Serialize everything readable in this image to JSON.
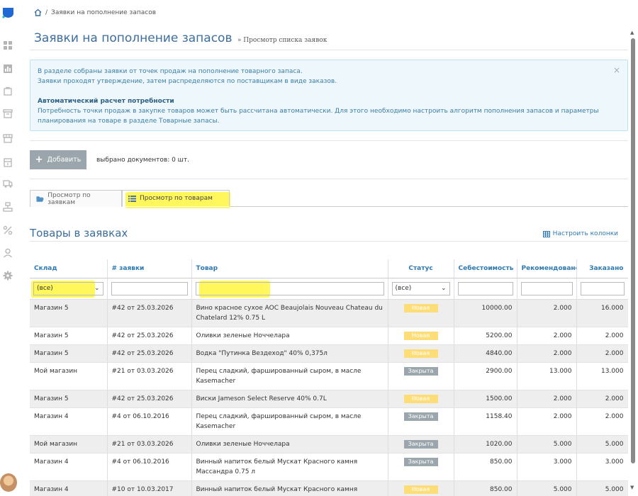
{
  "colors": {
    "accent": "#3b6e9e",
    "link": "#2f7ab3",
    "badge_new": "#fddd78",
    "badge_closed": "#9aa6ab",
    "highlight": "#fff64a"
  },
  "rail": {
    "icons": [
      "dashboard-icon",
      "chart-icon",
      "bag-icon",
      "archive-icon",
      "store-icon",
      "box-icon",
      "truck-icon",
      "org-icon",
      "percent-icon",
      "user-icon",
      "gear-icon"
    ]
  },
  "breadcrumb": {
    "separator": "/",
    "current": "Заявки на пополнение запасов"
  },
  "page": {
    "title": "Заявки на пополнение запасов",
    "subtitle": "» Просмотр списка заявок"
  },
  "info": {
    "line1": "В разделе собраны заявки от точек продаж на пополнение товарного запаса.",
    "line2_prefix": "Заявки проходят утверждение, затем распределяются по ",
    "line2_link": "поставщикам в виде заказов",
    "line2_suffix": ".",
    "heading": "Автоматический расчет потребности",
    "line3": "Потребность точки продаж в закупке товаров может быть рассчитана автоматически. Для этого необходимо настроить алгоритм пополнения запасов и параметры",
    "line4_prefix": "планирования на товаре в разделе ",
    "line4_link": "Товарные запасы",
    "line4_suffix": ".",
    "close": "×"
  },
  "toolbar": {
    "add_label": "Добавить",
    "selected_count": "выбрано документов: 0 шт."
  },
  "tabs": [
    {
      "label": "Просмотр по заявкам"
    },
    {
      "label": "Просмотр по товарам"
    }
  ],
  "section": {
    "title": "Товары в заявках",
    "configure_label": "Настроить колонки"
  },
  "table": {
    "headers": [
      "Склад",
      "# заявки",
      "Товар",
      "Статус",
      "Себестоимость",
      "Рекомендовано",
      "Заказано"
    ],
    "filters": {
      "warehouse": "(все)",
      "status": "(все)"
    },
    "rows": [
      {
        "warehouse": "Магазин 5",
        "order": "#42 от 25.03.2026",
        "product": "Вино красное сухое AOC Beaujolais Nouveau Chateau du Chatelard 12% 0.75 L",
        "status": "Новая",
        "status_type": "new",
        "cost": "10000.00",
        "recommended": "2.000",
        "ordered": "16.000"
      },
      {
        "warehouse": "Магазин 5",
        "order": "#42 от 25.03.2026",
        "product": "Оливки зеленые Ноччелара",
        "status": "Новая",
        "status_type": "new",
        "cost": "5200.00",
        "recommended": "2.000",
        "ordered": "2.000"
      },
      {
        "warehouse": "Магазин 5",
        "order": "#42 от 25.03.2026",
        "product": "Водка \"Путинка Вездеход\" 40% 0,375л",
        "status": "Новая",
        "status_type": "new",
        "cost": "4840.00",
        "recommended": "2.000",
        "ordered": "2.000"
      },
      {
        "warehouse": "Мой магазин",
        "order": "#21 от 03.03.2026",
        "product": "Перец сладкий, фаршированный сыром, в масле Kasemacher",
        "status": "Закрыта",
        "status_type": "closed",
        "cost": "2900.00",
        "recommended": "13.000",
        "ordered": "13.000"
      },
      {
        "warehouse": "Магазин 5",
        "order": "#42 от 25.03.2026",
        "product": "Виски Jameson Select Reserve 40% 0.7L",
        "status": "Новая",
        "status_type": "new",
        "cost": "1500.00",
        "recommended": "2.000",
        "ordered": "2.000"
      },
      {
        "warehouse": "Магазин 4",
        "order": "#4 от 06.10.2016",
        "product": "Перец сладкий, фаршированный сыром, в масле Kasemacher",
        "status": "Закрыта",
        "status_type": "closed",
        "cost": "1158.40",
        "recommended": "2.000",
        "ordered": "2.000"
      },
      {
        "warehouse": "Мой магазин",
        "order": "#21 от 03.03.2026",
        "product": "Оливки зеленые Ноччелара",
        "status": "Закрыта",
        "status_type": "closed",
        "cost": "1020.00",
        "recommended": "5.000",
        "ordered": "5.000"
      },
      {
        "warehouse": "Магазин 4",
        "order": "#4 от 06.10.2016",
        "product": "Винный напиток белый Мускат Красного камня Массандра 0.75 л",
        "status": "Закрыта",
        "status_type": "closed",
        "cost": "850.00",
        "recommended": "3.000",
        "ordered": "3.000"
      },
      {
        "warehouse": "Магазин 4",
        "order": "#10 от 10.03.2017",
        "product": "Винный напиток белый Мускат Красного камня",
        "status": "Новая",
        "status_type": "new",
        "cost": "850.00",
        "recommended": "5.000",
        "ordered": "5.000"
      }
    ]
  }
}
